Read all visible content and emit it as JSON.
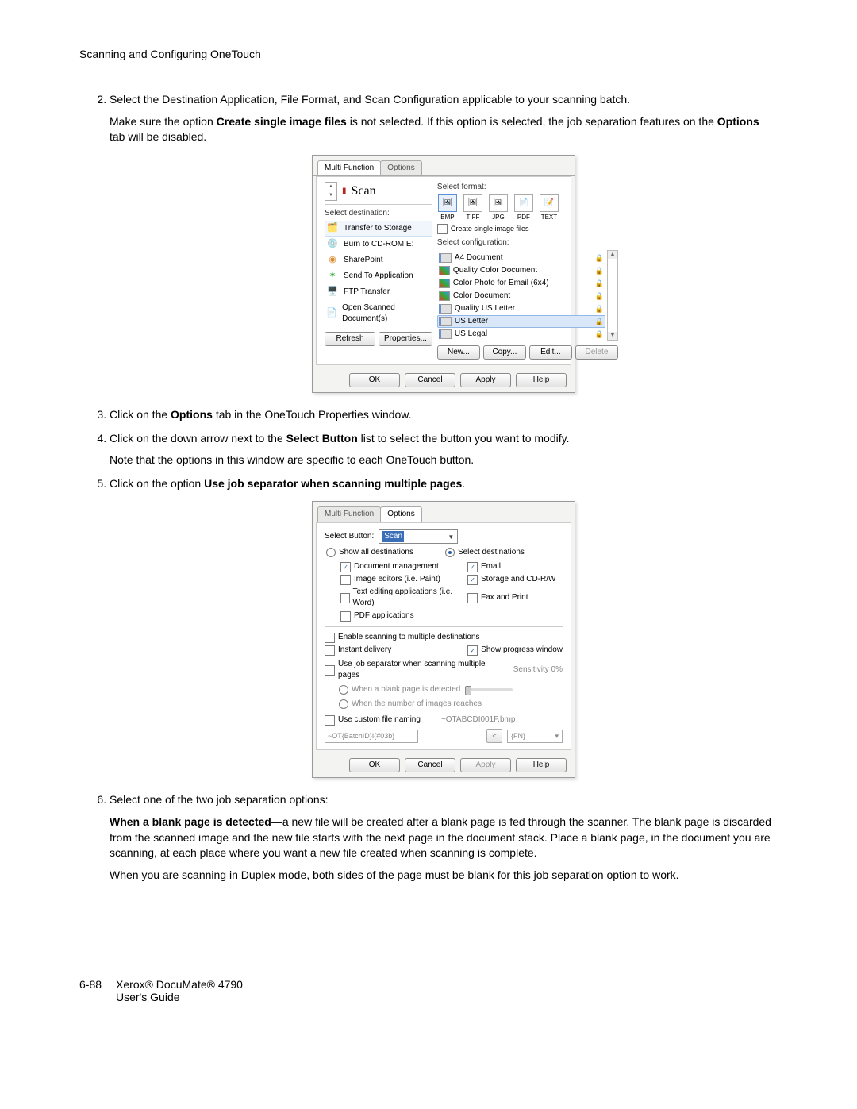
{
  "page": {
    "header": "Scanning and Configuring OneTouch",
    "footer_page": "6-88",
    "footer_line1": "Xerox® DocuMate® 4790",
    "footer_line2": "User's Guide"
  },
  "steps": {
    "s2a": "Select the Destination Application, File Format, and Scan Configuration applicable to your scanning batch.",
    "s2b_pre": "Make sure the option ",
    "s2b_bold": "Create single image files",
    "s2b_mid": " is not selected. If this option is selected, the job separation features on the ",
    "s2b_bold2": "Options",
    "s2b_post": " tab will be disabled.",
    "s3_pre": "Click on the ",
    "s3_bold": "Options",
    "s3_post": " tab in the OneTouch Properties window.",
    "s4_pre": "Click on the down arrow next to the ",
    "s4_bold": "Select Button",
    "s4_post": " list to select the button you want to modify.",
    "s4_sub": "Note that the options in this window are specific to each OneTouch button.",
    "s5_pre": "Click on the option ",
    "s5_bold": "Use job separator when scanning multiple pages",
    "s5_post": ".",
    "s6a": "Select one of the two job separation options:",
    "s6b_bold": "When a blank page is detected",
    "s6b_rest": "—a new file will be created after a blank page is fed through the scanner. The blank page is discarded from the scanned image and the new file starts with the next page in the document stack. Place a blank page, in the document you are scanning, at each place where you want a new file created when scanning is complete.",
    "s6c": "When you are scanning in Duplex mode, both sides of the page must be blank for this job separation option to work."
  },
  "dlg1": {
    "tab1": "Multi Function",
    "tab2": "Options",
    "scan_label": "Scan",
    "sel_dest": "Select destination:",
    "dests": [
      "Transfer to Storage",
      "Burn to CD-ROM  E:",
      "SharePoint",
      "Send To Application",
      "FTP Transfer",
      "Open Scanned Document(s)"
    ],
    "sel_fmt": "Select format:",
    "fmts": [
      "BMP",
      "TIFF",
      "JPG",
      "PDF",
      "TEXT"
    ],
    "create_single": "Create single image files",
    "sel_cfg": "Select configuration:",
    "cfgs": [
      "A4 Document",
      "Quality Color Document",
      "Color Photo for Email (6x4)",
      "Color Document",
      "Quality US Letter",
      "US Letter",
      "US Legal"
    ],
    "btn_refresh": "Refresh",
    "btn_props": "Properties...",
    "btn_new": "New...",
    "btn_copy": "Copy...",
    "btn_edit": "Edit...",
    "btn_delete": "Delete",
    "btn_ok": "OK",
    "btn_cancel": "Cancel",
    "btn_apply": "Apply",
    "btn_help": "Help"
  },
  "dlg2": {
    "tab1": "Multi Function",
    "tab2": "Options",
    "sel_btn_label": "Select Button:",
    "sel_btn_value": "Scan",
    "radio_show_all": "Show all destinations",
    "radio_select": "Select destinations",
    "chk_doc_mgmt": "Document management",
    "chk_email": "Email",
    "chk_image_ed": "Image editors (i.e. Paint)",
    "chk_storage": "Storage and CD-R/W",
    "chk_text_ed": "Text editing applications (i.e. Word)",
    "chk_fax": "Fax and Print",
    "chk_pdf": "PDF applications",
    "chk_enable_multi": "Enable scanning to multiple destinations",
    "chk_instant": "Instant delivery",
    "chk_progress": "Show progress window",
    "chk_jobsep": "Use job separator when scanning multiple pages",
    "sens_label": "Sensitivity",
    "sens_val": "0%",
    "radio_blank": "When a blank page is detected",
    "radio_count": "When the number of images reaches",
    "chk_custom": "Use custom file naming",
    "custom_preview": "~OTABCDI001F.bmp",
    "custom_pattern": "~OT{BatchID}I{#03b}",
    "fn_token": "{FN}",
    "btn_ok": "OK",
    "btn_cancel": "Cancel",
    "btn_apply": "Apply",
    "btn_help": "Help"
  }
}
